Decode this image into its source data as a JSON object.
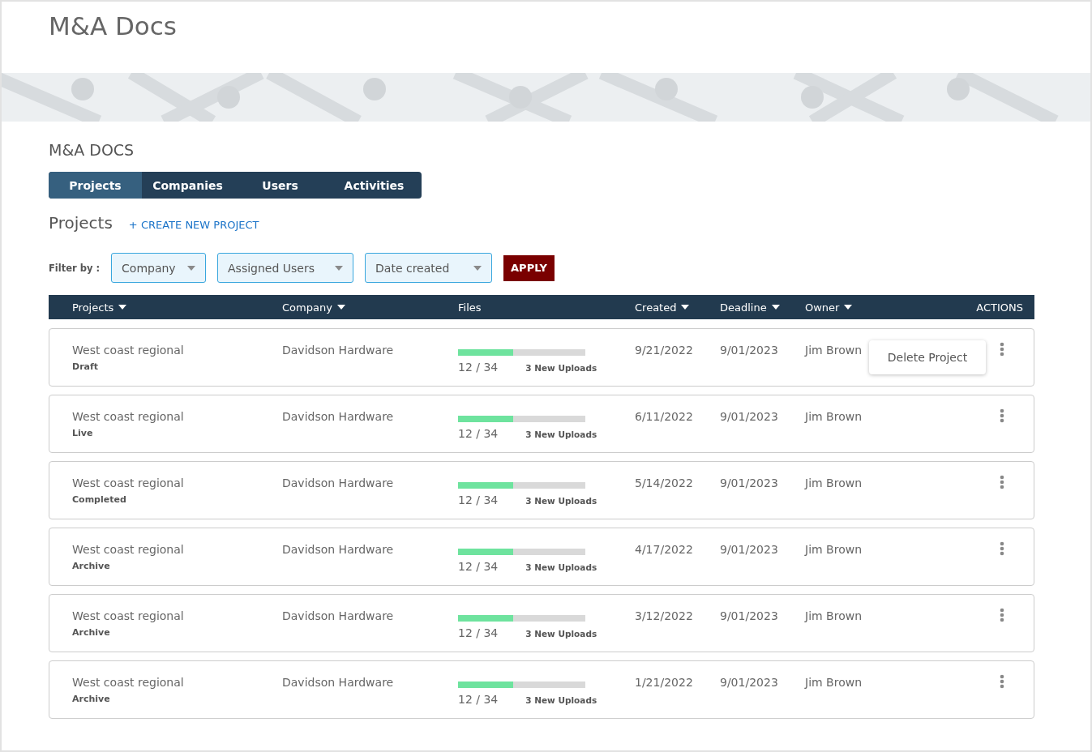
{
  "app_title": "M&A Docs",
  "section_title": "M&A DOCS",
  "tabs": [
    {
      "label": "Projects",
      "selected": true
    },
    {
      "label": "Companies",
      "selected": false
    },
    {
      "label": "Users",
      "selected": false
    },
    {
      "label": "Activities",
      "selected": false
    }
  ],
  "page_title": "Projects",
  "create_link": "+ CREATE NEW PROJECT",
  "filter_label": "Filter by :",
  "filters": [
    {
      "label": "Company"
    },
    {
      "label": "Assigned Users"
    },
    {
      "label": "Date created"
    }
  ],
  "apply_button": "APPLY",
  "table": {
    "columns": [
      {
        "label": "Projects",
        "sortable": true
      },
      {
        "label": "Company",
        "sortable": true
      },
      {
        "label": "Files",
        "sortable": false
      },
      {
        "label": "Created",
        "sortable": true
      },
      {
        "label": "Deadline",
        "sortable": true
      },
      {
        "label": "Owner",
        "sortable": true
      },
      {
        "label": "ACTIONS",
        "sortable": false
      }
    ],
    "rows": [
      {
        "project": "West coast regional",
        "status": "Draft",
        "company": "Davidson Hardware",
        "level": 0.43,
        "files_count": "12 / 34",
        "uploads": "3 New Uploads",
        "created": "9/21/2022",
        "deadline": "9/01/2023",
        "owner": "Jim Brown",
        "actions_menu": [
          "Delete Project"
        ]
      },
      {
        "project": "West coast regional",
        "status": "Live",
        "company": "Davidson Hardware",
        "level": 0.43,
        "files_count": "12 / 34",
        "uploads": "3 New Uploads",
        "created": "6/11/2022",
        "deadline": "9/01/2023",
        "owner": "Jim Brown"
      },
      {
        "project": "West coast regional",
        "status": "Completed",
        "company": "Davidson Hardware",
        "level": 0.43,
        "files_count": "12 / 34",
        "uploads": "3 New Uploads",
        "created": "5/14/2022",
        "deadline": "9/01/2023",
        "owner": "Jim Brown"
      },
      {
        "project": "West coast regional",
        "status": "Archive",
        "company": "Davidson Hardware",
        "level": 0.43,
        "files_count": "12 / 34",
        "uploads": "3 New Uploads",
        "created": "4/17/2022",
        "deadline": "9/01/2023",
        "owner": "Jim Brown"
      },
      {
        "project": "West coast regional",
        "status": "Archive",
        "company": "Davidson Hardware",
        "level": 0.43,
        "files_count": "12 / 34",
        "uploads": "3 New Uploads",
        "created": "3/12/2022",
        "deadline": "9/01/2023",
        "owner": "Jim Brown"
      },
      {
        "project": "West coast regional",
        "status": "Archive",
        "company": "Davidson Hardware",
        "level": 0.43,
        "files_count": "12 / 34",
        "uploads": "3 New Uploads",
        "created": "1/21/2022",
        "deadline": "9/01/2023",
        "owner": "Jim Brown"
      }
    ]
  }
}
